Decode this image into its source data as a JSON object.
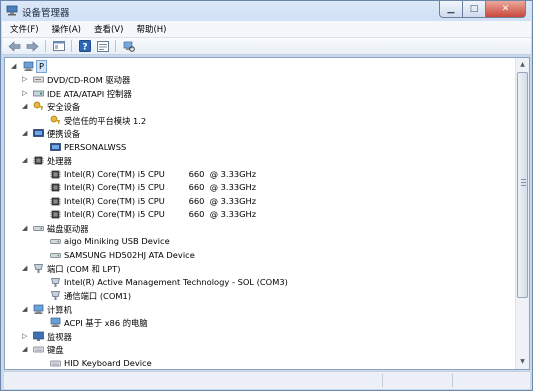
{
  "window": {
    "title": "设备管理器",
    "min_icon": "minimize-icon",
    "max_icon": "maximize-icon",
    "close_icon": "close-icon",
    "min_glyph": "▁",
    "max_glyph": "□",
    "close_glyph": "✕"
  },
  "menu": [
    "文件(F)",
    "操作(A)",
    "查看(V)",
    "帮助(H)"
  ],
  "toolbar": [
    "back-icon",
    "forward-icon",
    "console-tree-icon",
    "help-icon",
    "properties-icon",
    "scan-hardware-icon"
  ],
  "tree": {
    "root": "P",
    "nodes": [
      {
        "label": "DVD/CD-ROM 驱动器",
        "level": 1,
        "expander": "▷",
        "icon": "dvd-icon"
      },
      {
        "label": "IDE ATA/ATAPI 控制器",
        "level": 1,
        "expander": "▷",
        "icon": "ide-controller-icon"
      },
      {
        "label": "安全设备",
        "level": 1,
        "expander": "◢",
        "icon": "security-device-icon"
      },
      {
        "label": "受信任的平台模块 1.2",
        "level": 2,
        "expander": "",
        "icon": "tpm-icon"
      },
      {
        "label": "便携设备",
        "level": 1,
        "expander": "◢",
        "icon": "portable-device-icon"
      },
      {
        "label": "PERSONALWSS",
        "level": 2,
        "expander": "",
        "icon": "portable-device-icon"
      },
      {
        "label": "处理器",
        "level": 1,
        "expander": "◢",
        "icon": "processor-icon"
      },
      {
        "label": "Intel(R) Core(TM) i5 CPU         660  @ 3.33GHz",
        "level": 2,
        "expander": "",
        "icon": "processor-icon"
      },
      {
        "label": "Intel(R) Core(TM) i5 CPU         660  @ 3.33GHz",
        "level": 2,
        "expander": "",
        "icon": "processor-icon"
      },
      {
        "label": "Intel(R) Core(TM) i5 CPU         660  @ 3.33GHz",
        "level": 2,
        "expander": "",
        "icon": "processor-icon"
      },
      {
        "label": "Intel(R) Core(TM) i5 CPU         660  @ 3.33GHz",
        "level": 2,
        "expander": "",
        "icon": "processor-icon"
      },
      {
        "label": "磁盘驱动器",
        "level": 1,
        "expander": "◢",
        "icon": "disk-drive-icon"
      },
      {
        "label": "aigo Miniking USB Device",
        "level": 2,
        "expander": "",
        "icon": "disk-drive-icon"
      },
      {
        "label": "SAMSUNG HD502HJ ATA Device",
        "level": 2,
        "expander": "",
        "icon": "disk-drive-icon"
      },
      {
        "label": "端口 (COM 和 LPT)",
        "level": 1,
        "expander": "◢",
        "icon": "port-icon"
      },
      {
        "label": "Intel(R) Active Management Technology - SOL (COM3)",
        "level": 2,
        "expander": "",
        "icon": "port-icon"
      },
      {
        "label": "通信端口 (COM1)",
        "level": 2,
        "expander": "",
        "icon": "port-icon"
      },
      {
        "label": "计算机",
        "level": 1,
        "expander": "◢",
        "icon": "computer-icon"
      },
      {
        "label": "ACPI 基于 x86 的电脑",
        "level": 2,
        "expander": "",
        "icon": "computer-icon"
      },
      {
        "label": "监视器",
        "level": 1,
        "expander": "▷",
        "icon": "monitor-icon"
      },
      {
        "label": "键盘",
        "level": 1,
        "expander": "◢",
        "icon": "keyboard-icon"
      },
      {
        "label": "HID Keyboard Device",
        "level": 2,
        "expander": "",
        "icon": "keyboard-icon"
      }
    ]
  },
  "scrollbar": {
    "up": "▲",
    "down": "▼"
  }
}
